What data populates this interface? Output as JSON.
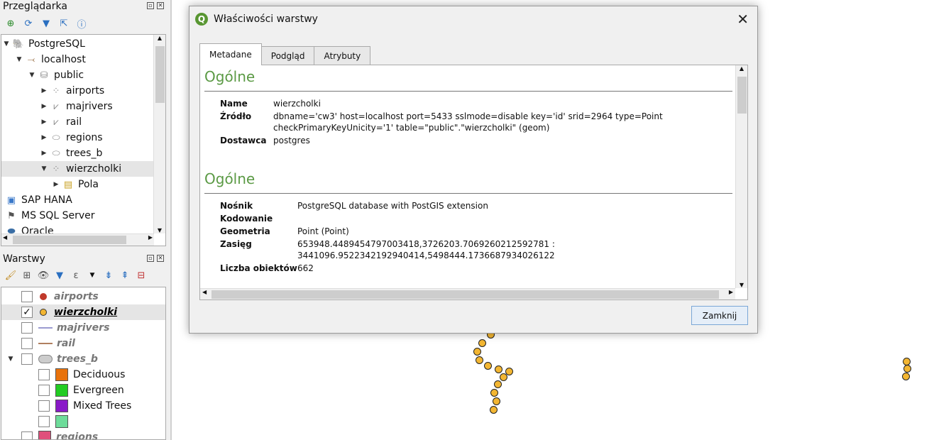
{
  "browser": {
    "title": "Przeglądarka",
    "tree": [
      {
        "label": "PostgreSQL",
        "icon": "elephant-icon"
      },
      {
        "label": "localhost",
        "icon": "connection-icon"
      },
      {
        "label": "public",
        "icon": "database-icon"
      },
      {
        "label": "airports",
        "icon": "point-layer-icon"
      },
      {
        "label": "majrivers",
        "icon": "line-layer-icon"
      },
      {
        "label": "rail",
        "icon": "line-layer-icon"
      },
      {
        "label": "regions",
        "icon": "polygon-layer-icon"
      },
      {
        "label": "trees_b",
        "icon": "polygon-layer-icon"
      },
      {
        "label": "wierzcholki",
        "icon": "point-layer-icon"
      },
      {
        "label": "Pola",
        "icon": "fields-icon"
      },
      {
        "label": "SAP HANA",
        "icon": "sap-hana-icon"
      },
      {
        "label": "MS SQL Server",
        "icon": "mssql-icon"
      },
      {
        "label": "Oracle",
        "icon": "oracle-icon"
      }
    ]
  },
  "layers": {
    "title": "Warstwy",
    "items": [
      {
        "label": "airports",
        "checked": false,
        "color": "#c0392b"
      },
      {
        "label": "wierzcholki",
        "checked": true,
        "color": "#f3b632"
      },
      {
        "label": "majrivers",
        "checked": false,
        "color": "#9b9bd0"
      },
      {
        "label": "rail",
        "checked": false,
        "color": "#b08060"
      },
      {
        "label": "trees_b",
        "checked": false,
        "color": "#cccccc"
      },
      {
        "label": "Deciduous",
        "checked": false,
        "color": "#e8720c"
      },
      {
        "label": "Evergreen",
        "checked": false,
        "color": "#22cc22"
      },
      {
        "label": "Mixed Trees",
        "checked": false,
        "color": "#8a1ac8"
      },
      {
        "label": "",
        "checked": false,
        "color": "#6edc9a"
      },
      {
        "label": "regions",
        "checked": false,
        "color": "#e0507c"
      }
    ]
  },
  "dialog": {
    "title": "Właściwości warstwy",
    "tabs": [
      "Metadane",
      "Podgląd",
      "Atrybuty"
    ],
    "section1": {
      "heading": "Ogólne",
      "name_label": "Name",
      "name_value": "wierzcholki",
      "source_label": "Źródło",
      "source_line1": "dbname='cw3' host=localhost port=5433 sslmode=disable key='id' srid=2964 type=Point",
      "source_line2": "checkPrimaryKeyUnicity='1' table=\"public\".\"wierzcholki\" (geom)",
      "provider_label": "Dostawca",
      "provider_value": "postgres"
    },
    "section2": {
      "heading": "Ogólne",
      "storage_label": "Nośnik",
      "storage_value": "PostgreSQL database with PostGIS extension",
      "encoding_label": "Kodowanie",
      "encoding_value": "",
      "geometry_label": "Geometria",
      "geometry_value": "Point (Point)",
      "extent_label": "Zasięg",
      "extent_line1": "653948.4489454797003418,3726203.7069260212592781 :",
      "extent_line2": "3441096.9522342192940414,5498444.1736687934026122",
      "count_label": "Liczba obiektów",
      "count_value": "662"
    },
    "close_button": "Zamknij"
  }
}
